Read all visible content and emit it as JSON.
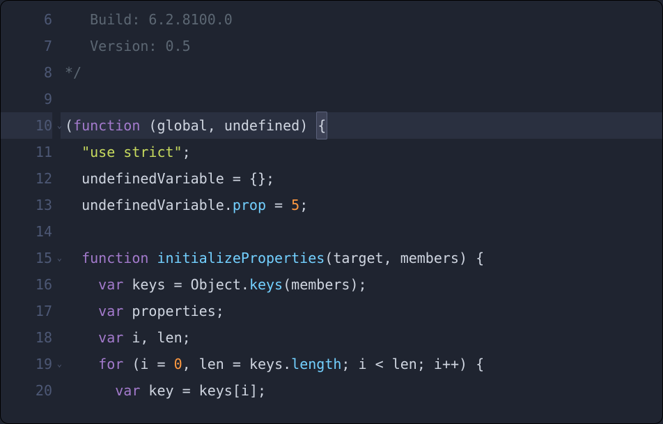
{
  "lines": [
    {
      "num": "6",
      "fold": false,
      "hl": false,
      "tokens": [
        {
          "cls": "c-comment",
          "text": "   Build: 6.2.8100.0"
        }
      ]
    },
    {
      "num": "7",
      "fold": false,
      "hl": false,
      "tokens": [
        {
          "cls": "c-comment",
          "text": "   Version: 0.5"
        }
      ]
    },
    {
      "num": "8",
      "fold": false,
      "hl": false,
      "tokens": [
        {
          "cls": "c-comment",
          "text": "*/"
        }
      ]
    },
    {
      "num": "9",
      "fold": false,
      "hl": false,
      "tokens": []
    },
    {
      "num": "10",
      "fold": true,
      "hl": true,
      "tokens": [
        {
          "cls": "c-punct",
          "text": "("
        },
        {
          "cls": "c-keyword",
          "text": "function"
        },
        {
          "cls": "c-punct",
          "text": " ("
        },
        {
          "cls": "c-var",
          "text": "global"
        },
        {
          "cls": "c-punct",
          "text": ", "
        },
        {
          "cls": "c-var",
          "text": "undefined"
        },
        {
          "cls": "c-punct",
          "text": ") "
        },
        {
          "cls": "c-punct brace-hl",
          "text": "{"
        }
      ]
    },
    {
      "num": "11",
      "fold": false,
      "hl": false,
      "tokens": [
        {
          "cls": "",
          "text": "  "
        },
        {
          "cls": "c-string",
          "text": "\"use strict\""
        },
        {
          "cls": "c-punct",
          "text": ";"
        }
      ]
    },
    {
      "num": "12",
      "fold": false,
      "hl": false,
      "tokens": [
        {
          "cls": "",
          "text": "  "
        },
        {
          "cls": "c-var",
          "text": "undefinedVariable"
        },
        {
          "cls": "c-punct",
          "text": " = {};"
        }
      ]
    },
    {
      "num": "13",
      "fold": false,
      "hl": false,
      "tokens": [
        {
          "cls": "",
          "text": "  "
        },
        {
          "cls": "c-var",
          "text": "undefinedVariable"
        },
        {
          "cls": "c-punct",
          "text": "."
        },
        {
          "cls": "c-prop",
          "text": "prop"
        },
        {
          "cls": "c-punct",
          "text": " = "
        },
        {
          "cls": "c-num",
          "text": "5"
        },
        {
          "cls": "c-punct",
          "text": ";"
        }
      ]
    },
    {
      "num": "14",
      "fold": false,
      "hl": false,
      "tokens": []
    },
    {
      "num": "15",
      "fold": true,
      "hl": false,
      "tokens": [
        {
          "cls": "",
          "text": "  "
        },
        {
          "cls": "c-keyword",
          "text": "function"
        },
        {
          "cls": "c-punct",
          "text": " "
        },
        {
          "cls": "c-func",
          "text": "initializeProperties"
        },
        {
          "cls": "c-punct",
          "text": "("
        },
        {
          "cls": "c-var",
          "text": "target"
        },
        {
          "cls": "c-punct",
          "text": ", "
        },
        {
          "cls": "c-var",
          "text": "members"
        },
        {
          "cls": "c-punct",
          "text": ") {"
        }
      ]
    },
    {
      "num": "16",
      "fold": false,
      "hl": false,
      "tokens": [
        {
          "cls": "",
          "text": "    "
        },
        {
          "cls": "c-keyword",
          "text": "var"
        },
        {
          "cls": "c-punct",
          "text": " "
        },
        {
          "cls": "c-var",
          "text": "keys"
        },
        {
          "cls": "c-punct",
          "text": " = "
        },
        {
          "cls": "c-type",
          "text": "Object"
        },
        {
          "cls": "c-punct",
          "text": "."
        },
        {
          "cls": "c-func",
          "text": "keys"
        },
        {
          "cls": "c-punct",
          "text": "("
        },
        {
          "cls": "c-var",
          "text": "members"
        },
        {
          "cls": "c-punct",
          "text": ");"
        }
      ]
    },
    {
      "num": "17",
      "fold": false,
      "hl": false,
      "tokens": [
        {
          "cls": "",
          "text": "    "
        },
        {
          "cls": "c-keyword",
          "text": "var"
        },
        {
          "cls": "c-punct",
          "text": " "
        },
        {
          "cls": "c-var",
          "text": "properties"
        },
        {
          "cls": "c-punct",
          "text": ";"
        }
      ]
    },
    {
      "num": "18",
      "fold": false,
      "hl": false,
      "tokens": [
        {
          "cls": "",
          "text": "    "
        },
        {
          "cls": "c-keyword",
          "text": "var"
        },
        {
          "cls": "c-punct",
          "text": " "
        },
        {
          "cls": "c-var",
          "text": "i"
        },
        {
          "cls": "c-punct",
          "text": ", "
        },
        {
          "cls": "c-var",
          "text": "len"
        },
        {
          "cls": "c-punct",
          "text": ";"
        }
      ]
    },
    {
      "num": "19",
      "fold": true,
      "hl": false,
      "tokens": [
        {
          "cls": "",
          "text": "    "
        },
        {
          "cls": "c-keyword",
          "text": "for"
        },
        {
          "cls": "c-punct",
          "text": " ("
        },
        {
          "cls": "c-var",
          "text": "i"
        },
        {
          "cls": "c-punct",
          "text": " = "
        },
        {
          "cls": "c-num",
          "text": "0"
        },
        {
          "cls": "c-punct",
          "text": ", "
        },
        {
          "cls": "c-var",
          "text": "len"
        },
        {
          "cls": "c-punct",
          "text": " = "
        },
        {
          "cls": "c-var",
          "text": "keys"
        },
        {
          "cls": "c-punct",
          "text": "."
        },
        {
          "cls": "c-prop",
          "text": "length"
        },
        {
          "cls": "c-punct",
          "text": "; "
        },
        {
          "cls": "c-var",
          "text": "i"
        },
        {
          "cls": "c-punct",
          "text": " < "
        },
        {
          "cls": "c-var",
          "text": "len"
        },
        {
          "cls": "c-punct",
          "text": "; "
        },
        {
          "cls": "c-var",
          "text": "i"
        },
        {
          "cls": "c-punct",
          "text": "++) {"
        }
      ]
    },
    {
      "num": "20",
      "fold": false,
      "hl": false,
      "tokens": [
        {
          "cls": "",
          "text": "      "
        },
        {
          "cls": "c-keyword",
          "text": "var"
        },
        {
          "cls": "c-punct",
          "text": " "
        },
        {
          "cls": "c-var",
          "text": "key"
        },
        {
          "cls": "c-punct",
          "text": " = "
        },
        {
          "cls": "c-var",
          "text": "keys"
        },
        {
          "cls": "c-punct",
          "text": "["
        },
        {
          "cls": "c-var",
          "text": "i"
        },
        {
          "cls": "c-punct",
          "text": "];"
        }
      ]
    }
  ],
  "foldGlyph": "⌄"
}
